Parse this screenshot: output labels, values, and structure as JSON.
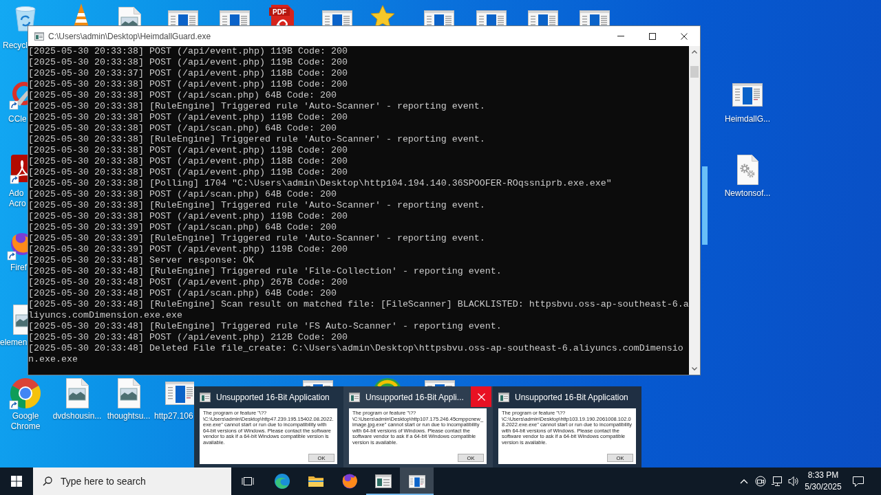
{
  "desktop": {
    "pdf_icon_text": "PDF",
    "icons": [
      {
        "label": "Recycl"
      },
      {
        "label": "CCle"
      },
      {
        "label": "Ado Acro"
      },
      {
        "label": "Firef"
      },
      {
        "label": "elemen"
      },
      {
        "label": "Google Chrome"
      },
      {
        "label": "dvdshousin..."
      },
      {
        "label": "thoughtsu..."
      },
      {
        "label": "http27.106"
      },
      {
        "label": "HeimdallG..."
      },
      {
        "label": "Newtonsof..."
      }
    ]
  },
  "console_window": {
    "title": "C:\\Users\\admin\\Desktop\\HeimdallGuard.exe",
    "lines": [
      "[2025-05-30 20:33:38] POST (/api/event.php) 119B Code: 200",
      "[2025-05-30 20:33:38] POST (/api/event.php) 119B Code: 200",
      "[2025-05-30 20:33:37] POST (/api/event.php) 118B Code: 200",
      "[2025-05-30 20:33:38] POST (/api/event.php) 119B Code: 200",
      "[2025-05-30 20:33:38] POST (/api/scan.php) 64B Code: 200",
      "[2025-05-30 20:33:38] [RuleEngine] Triggered rule 'Auto-Scanner' - reporting event.",
      "[2025-05-30 20:33:38] POST (/api/event.php) 119B Code: 200",
      "[2025-05-30 20:33:38] POST (/api/scan.php) 64B Code: 200",
      "[2025-05-30 20:33:38] [RuleEngine] Triggered rule 'Auto-Scanner' - reporting event.",
      "[2025-05-30 20:33:38] POST (/api/event.php) 119B Code: 200",
      "[2025-05-30 20:33:38] POST (/api/event.php) 118B Code: 200",
      "[2025-05-30 20:33:38] POST (/api/event.php) 119B Code: 200",
      "[2025-05-30 20:33:38] [Polling] 1704 \"C:\\Users\\admin\\Desktop\\http104.194.140.36SPOOFER-ROqssniprb.exe.exe\"",
      "[2025-05-30 20:33:38] POST (/api/scan.php) 64B Code: 200",
      "[2025-05-30 20:33:38] [RuleEngine] Triggered rule 'Auto-Scanner' - reporting event.",
      "[2025-05-30 20:33:38] POST (/api/event.php) 119B Code: 200",
      "[2025-05-30 20:33:39] POST (/api/scan.php) 64B Code: 200",
      "[2025-05-30 20:33:39] [RuleEngine] Triggered rule 'Auto-Scanner' - reporting event.",
      "[2025-05-30 20:33:39] POST (/api/event.php) 119B Code: 200",
      "[2025-05-30 20:33:48] Server response: OK",
      "[2025-05-30 20:33:48] [RuleEngine] Triggered rule 'File-Collection' - reporting event.",
      "[2025-05-30 20:33:48] POST (/api/event.php) 267B Code: 200",
      "[2025-05-30 20:33:48] POST (/api/scan.php) 64B Code: 200",
      "[2025-05-30 20:33:48] [RuleEngine] Scan result on matched file: [FileScanner] BLACKLISTED: httpsbvu.oss-ap-southeast-6.aliyuncs.comDimension.exe.exe",
      "[2025-05-30 20:33:48] [RuleEngine] Triggered rule 'FS Auto-Scanner' - reporting event.",
      "[2025-05-30 20:33:48] POST (/api/event.php) 212B Code: 200",
      "[2025-05-30 20:33:48] Deleted File file_create: C:\\Users\\admin\\Desktop\\httpsbvu.oss-ap-southeast-6.aliyuncs.comDimension.exe.exe"
    ]
  },
  "taskbar_previews": [
    {
      "title": "Unsupported 16-Bit Application",
      "hovered": false,
      "message": "The program or feature \"\\??\\C:\\Users\\admin\\Desktop\\http47.239.195.15402.08.2022.exe.exe\" cannot start or run due to incompatibility with 64-bit versions of Windows. Please contact the software vendor to ask if a 64-bit Windows compatible version is available.",
      "button": "OK"
    },
    {
      "title": "Unsupported 16-Bit Appli...",
      "hovered": true,
      "message": "The program or feature \"\\??\\C:\\Users\\admin\\Desktop\\http107.175.246.45cmppcnew_image.jpg.exe\" cannot start or run due to incompatibility with 64-bit versions of Windows. Please contact the software vendor to ask if a 64-bit Windows compatible version is available.",
      "button": "OK"
    },
    {
      "title": "Unsupported 16-Bit Application",
      "hovered": false,
      "message": "The program or feature \"\\??\\C:\\Users\\admin\\Desktop\\http103.19.190.2061008.102.08.2022.exe.exe\" cannot start or run due to incompatibility with 64-bit versions of Windows. Please contact the software vendor to ask if a 64-bit Windows compatible version is available.",
      "button": "OK"
    }
  ],
  "taskbar": {
    "search": {
      "placeholder": "Type here to search"
    },
    "apps": [
      {
        "selected": false,
        "running": false
      },
      {
        "selected": false,
        "running": false
      },
      {
        "selected": false,
        "running": false
      },
      {
        "selected": false,
        "running": true
      },
      {
        "selected": true,
        "running": true
      }
    ],
    "clock": {
      "time": "8:33 PM",
      "date": "5/30/2025"
    }
  }
}
